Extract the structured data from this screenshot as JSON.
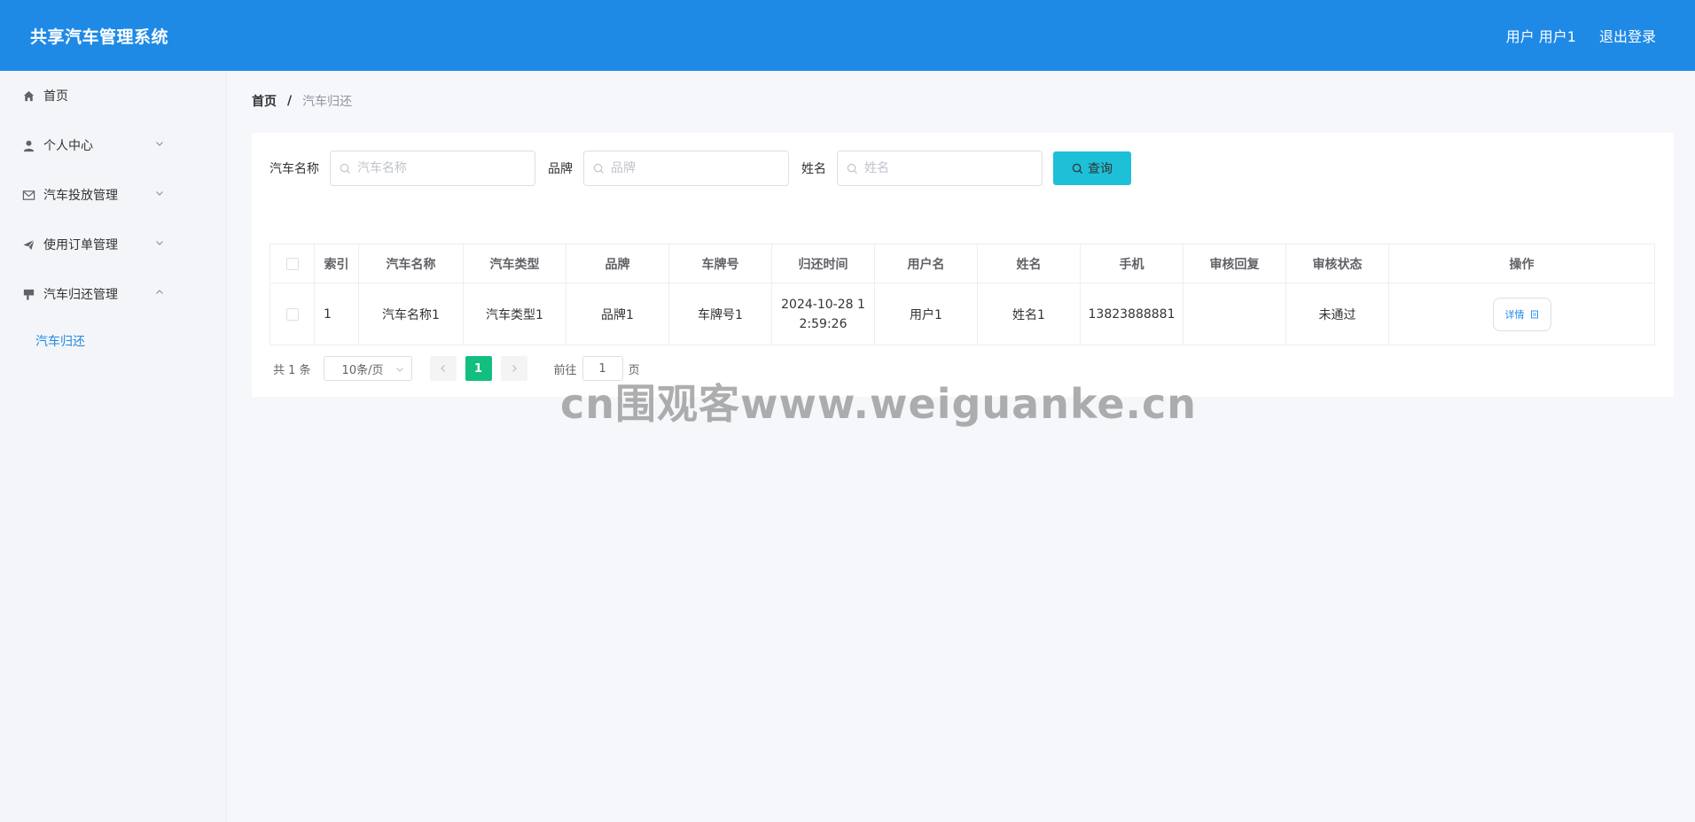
{
  "header": {
    "title": "共享汽车管理系统",
    "user_label": "用户 用户1",
    "logout_label": "退出登录"
  },
  "sidebar": {
    "items": [
      {
        "label": "首页",
        "icon": "home-icon"
      },
      {
        "label": "个人中心",
        "icon": "user-icon",
        "expanded": false
      },
      {
        "label": "汽车投放管理",
        "icon": "mail-icon",
        "expanded": false
      },
      {
        "label": "使用订单管理",
        "icon": "send-icon",
        "expanded": false
      },
      {
        "label": "汽车归还管理",
        "icon": "flag-icon",
        "expanded": true
      }
    ],
    "sub_item": "汽车归还",
    "active_color": "#1f8ae6"
  },
  "breadcrumb": {
    "home": "首页",
    "separator": "/",
    "current": "汽车归还"
  },
  "search": {
    "car_name_label": "汽车名称",
    "car_name_placeholder": "汽车名称",
    "brand_label": "品牌",
    "brand_placeholder": "品牌",
    "name_label": "姓名",
    "name_placeholder": "姓名",
    "query_label": "查询"
  },
  "table": {
    "headers": [
      "索引",
      "汽车名称",
      "汽车类型",
      "品牌",
      "车牌号",
      "归还时间",
      "用户名",
      "姓名",
      "手机",
      "审核回复",
      "审核状态",
      "操作"
    ],
    "rows": [
      {
        "index": "1",
        "car_name": "汽车名称1",
        "car_type": "汽车类型1",
        "brand": "品牌1",
        "plate": "车牌号1",
        "return_time_line1": "2024-10-28 1",
        "return_time_line2": "2:59:26",
        "username": "用户1",
        "name": "姓名1",
        "phone": "13823888881",
        "reply": "",
        "status": "未通过",
        "action": "详情"
      }
    ]
  },
  "pagination": {
    "total": "共 1 条",
    "page_size": "10条/页",
    "current_page": "1",
    "goto_label": "前往",
    "goto_value": "1",
    "goto_suffix": "页"
  },
  "watermark": "cn围观客www.weiguanke.cn",
  "colors": {
    "header_bg": "#1f8ae6",
    "query_btn": "#1ec0d8",
    "active_page": "#13bf7f"
  }
}
